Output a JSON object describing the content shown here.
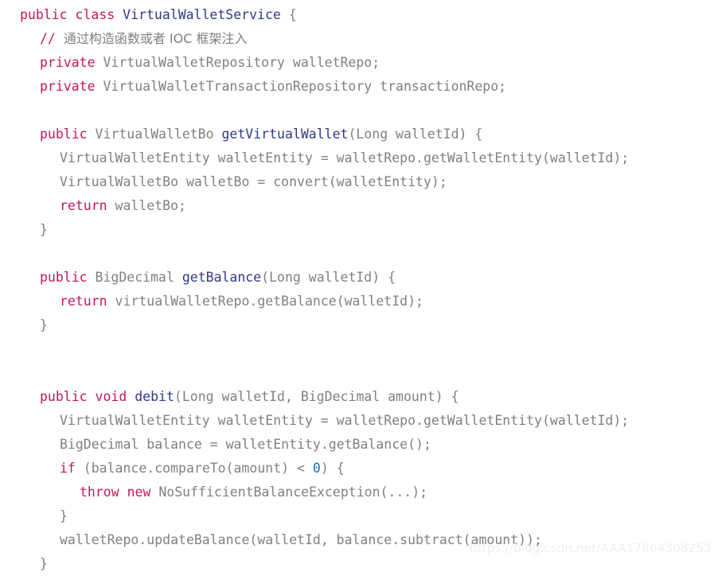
{
  "editor": {
    "language": "Java",
    "background": "#ffffff",
    "colors": {
      "keyword": "#c2185b",
      "declaration_name": "#2e3a87",
      "plain": "#808080",
      "number": "#1a6fc4",
      "comment": "#7f7f7f",
      "watermark": "#efefef"
    }
  },
  "watermark": {
    "text": "https://blog.csdn.net/AAA17864308253"
  },
  "code": {
    "lines": [
      {
        "id": 0,
        "indent": 0,
        "tokens": [
          {
            "t": "public",
            "k": "kw"
          },
          {
            "t": " ",
            "k": "plain"
          },
          {
            "t": "class",
            "k": "kw"
          },
          {
            "t": " ",
            "k": "plain"
          },
          {
            "t": "VirtualWalletService",
            "k": "decl"
          },
          {
            "t": " {",
            "k": "plain"
          }
        ]
      },
      {
        "id": 1,
        "indent": 1,
        "tokens": [
          {
            "t": "// ",
            "k": "cmtmark"
          },
          {
            "t": "通过构造函数或者 IOC 框架注入",
            "k": "cjk"
          }
        ]
      },
      {
        "id": 2,
        "indent": 1,
        "tokens": [
          {
            "t": "private",
            "k": "kw"
          },
          {
            "t": " VirtualWalletRepository walletRepo;",
            "k": "plain"
          }
        ]
      },
      {
        "id": 3,
        "indent": 1,
        "tokens": [
          {
            "t": "private",
            "k": "kw"
          },
          {
            "t": " VirtualWalletTransactionRepository transactionRepo;",
            "k": "plain"
          }
        ]
      },
      {
        "id": 4,
        "indent": 0,
        "tokens": []
      },
      {
        "id": 5,
        "indent": 1,
        "tokens": [
          {
            "t": "public",
            "k": "kw"
          },
          {
            "t": " VirtualWalletBo ",
            "k": "plain"
          },
          {
            "t": "getVirtualWallet",
            "k": "decl"
          },
          {
            "t": "(Long walletId) {",
            "k": "plain"
          }
        ]
      },
      {
        "id": 6,
        "indent": 2,
        "tokens": [
          {
            "t": "VirtualWalletEntity walletEntity = walletRepo.getWalletEntity(walletId);",
            "k": "plain"
          }
        ]
      },
      {
        "id": 7,
        "indent": 2,
        "tokens": [
          {
            "t": "VirtualWalletBo walletBo = convert(walletEntity);",
            "k": "plain"
          }
        ]
      },
      {
        "id": 8,
        "indent": 2,
        "tokens": [
          {
            "t": "return",
            "k": "kw"
          },
          {
            "t": " walletBo;",
            "k": "plain"
          }
        ]
      },
      {
        "id": 9,
        "indent": 1,
        "tokens": [
          {
            "t": "}",
            "k": "plain"
          }
        ]
      },
      {
        "id": 10,
        "indent": 0,
        "tokens": []
      },
      {
        "id": 11,
        "indent": 1,
        "tokens": [
          {
            "t": "public",
            "k": "kw"
          },
          {
            "t": " BigDecimal ",
            "k": "plain"
          },
          {
            "t": "getBalance",
            "k": "decl"
          },
          {
            "t": "(Long walletId) {",
            "k": "plain"
          }
        ]
      },
      {
        "id": 12,
        "indent": 2,
        "tokens": [
          {
            "t": "return",
            "k": "kw"
          },
          {
            "t": " virtualWalletRepo.getBalance(walletId);",
            "k": "plain"
          }
        ]
      },
      {
        "id": 13,
        "indent": 1,
        "tokens": [
          {
            "t": "}",
            "k": "plain"
          }
        ]
      },
      {
        "id": 14,
        "indent": 0,
        "tokens": []
      },
      {
        "id": 15,
        "indent": 0,
        "tokens": []
      },
      {
        "id": 16,
        "indent": 1,
        "tokens": [
          {
            "t": "public",
            "k": "kw"
          },
          {
            "t": " ",
            "k": "plain"
          },
          {
            "t": "void",
            "k": "kw"
          },
          {
            "t": " ",
            "k": "plain"
          },
          {
            "t": "debit",
            "k": "decl"
          },
          {
            "t": "(Long walletId, BigDecimal amount) {",
            "k": "plain"
          }
        ]
      },
      {
        "id": 17,
        "indent": 2,
        "tokens": [
          {
            "t": "VirtualWalletEntity walletEntity = walletRepo.getWalletEntity(walletId);",
            "k": "plain"
          }
        ]
      },
      {
        "id": 18,
        "indent": 2,
        "tokens": [
          {
            "t": "BigDecimal balance = walletEntity.getBalance();",
            "k": "plain"
          }
        ]
      },
      {
        "id": 19,
        "indent": 2,
        "tokens": [
          {
            "t": "if",
            "k": "kw"
          },
          {
            "t": " (balance.compareTo(amount) < ",
            "k": "plain"
          },
          {
            "t": "0",
            "k": "num"
          },
          {
            "t": ") {",
            "k": "plain"
          }
        ]
      },
      {
        "id": 20,
        "indent": 3,
        "tokens": [
          {
            "t": "throw",
            "k": "kw"
          },
          {
            "t": " ",
            "k": "plain"
          },
          {
            "t": "new",
            "k": "kw"
          },
          {
            "t": " NoSufficientBalanceException(...);",
            "k": "plain"
          }
        ]
      },
      {
        "id": 21,
        "indent": 2,
        "tokens": [
          {
            "t": "}",
            "k": "plain"
          }
        ]
      },
      {
        "id": 22,
        "indent": 2,
        "tokens": [
          {
            "t": "walletRepo.updateBalance(walletId, balance.subtract(amount));",
            "k": "plain"
          }
        ]
      },
      {
        "id": 23,
        "indent": 1,
        "tokens": [
          {
            "t": "}",
            "k": "plain"
          }
        ]
      }
    ]
  }
}
